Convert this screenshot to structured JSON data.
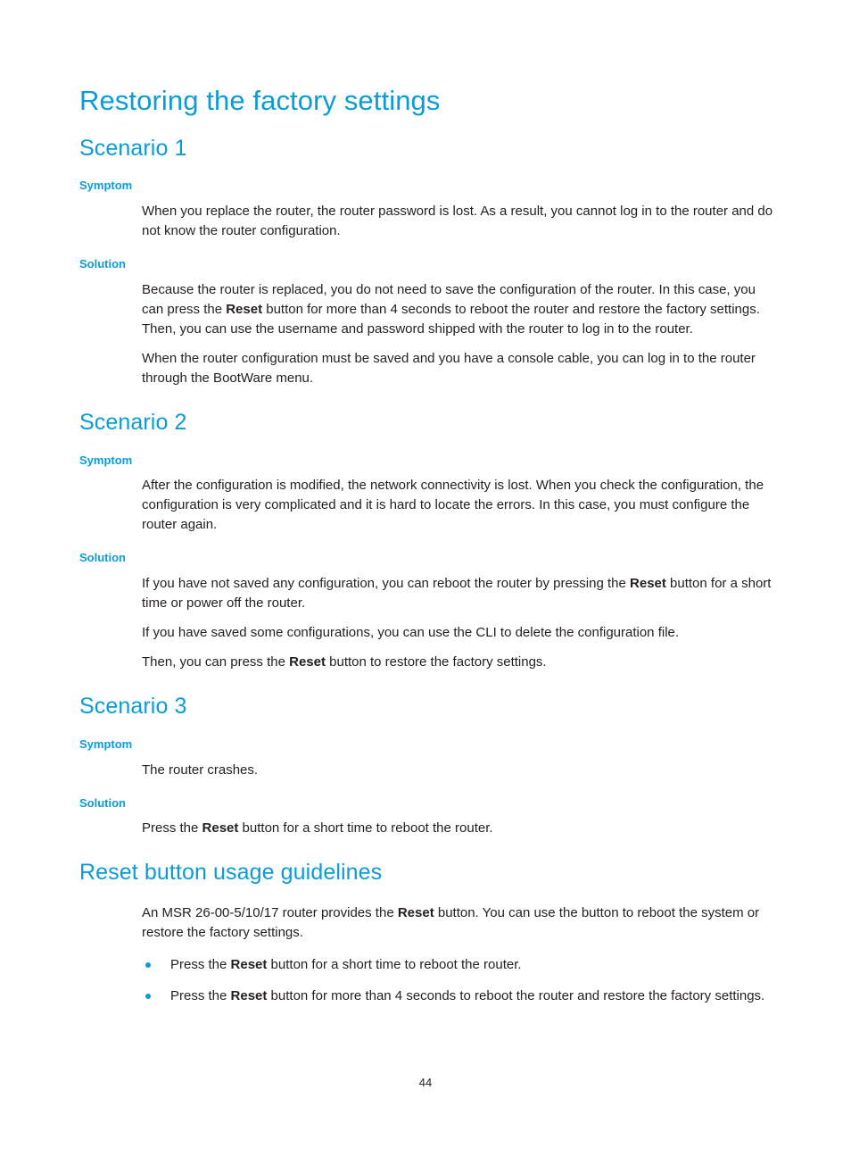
{
  "document": {
    "title": "Restoring the factory settings",
    "page_number": "44",
    "accent_color": "#0b9cd8",
    "body_color": "#231f20"
  },
  "labels": {
    "symptom": "Symptom",
    "solution": "Solution",
    "reset_bold": "Reset"
  },
  "scenario1": {
    "heading": "Scenario 1",
    "symptom": {
      "label": "Symptom",
      "text": "When you replace the router, the router password is lost. As a result, you cannot log in to the router and do not know the router configuration."
    },
    "solution": {
      "label": "Solution",
      "para1_a": "Because the router is replaced, you do not need to save the configuration of the router. In this case, you can press the ",
      "para1_b": "Reset",
      "para1_c": " button for more than 4 seconds to reboot the router and restore the factory settings. Then, you can use the username and password shipped with the router to log in to the router.",
      "para2": "When the router configuration must be saved and you have a console cable, you can log in to the router through the BootWare menu."
    }
  },
  "scenario2": {
    "heading": "Scenario 2",
    "symptom": {
      "label": "Symptom",
      "text": "After the configuration is modified, the network connectivity is lost. When you check the configuration, the configuration is very complicated and it is hard to locate the errors. In this case, you must configure the router again."
    },
    "solution": {
      "label": "Solution",
      "para1_a": "If you have not saved any configuration, you can reboot the router by pressing the ",
      "para1_b": "Reset",
      "para1_c": " button for a short time or power off the router.",
      "para2": "If you have saved some configurations, you can use the CLI to delete the configuration file.",
      "para3_a": "Then, you can press the ",
      "para3_b": "Reset",
      "para3_c": " button to restore the factory settings."
    }
  },
  "scenario3": {
    "heading": "Scenario 3",
    "symptom": {
      "label": "Symptom",
      "text": "The router crashes."
    },
    "solution": {
      "label": "Solution",
      "para1_a": "Press the ",
      "para1_b": "Reset",
      "para1_c": " button for a short time to reboot the router."
    }
  },
  "reset_guidelines": {
    "heading": "Reset button usage guidelines",
    "intro_a": "An MSR 26-00-5/10/17 router provides the ",
    "intro_b": "Reset",
    "intro_c": " button. You can use the button to reboot the system or restore the factory settings.",
    "bullets": [
      {
        "a": "Press the ",
        "b": "Reset",
        "c": " button for a short time to reboot the router."
      },
      {
        "a": "Press the ",
        "b": "Reset",
        "c": " button for more than 4 seconds to reboot the router and restore the factory settings."
      }
    ]
  }
}
